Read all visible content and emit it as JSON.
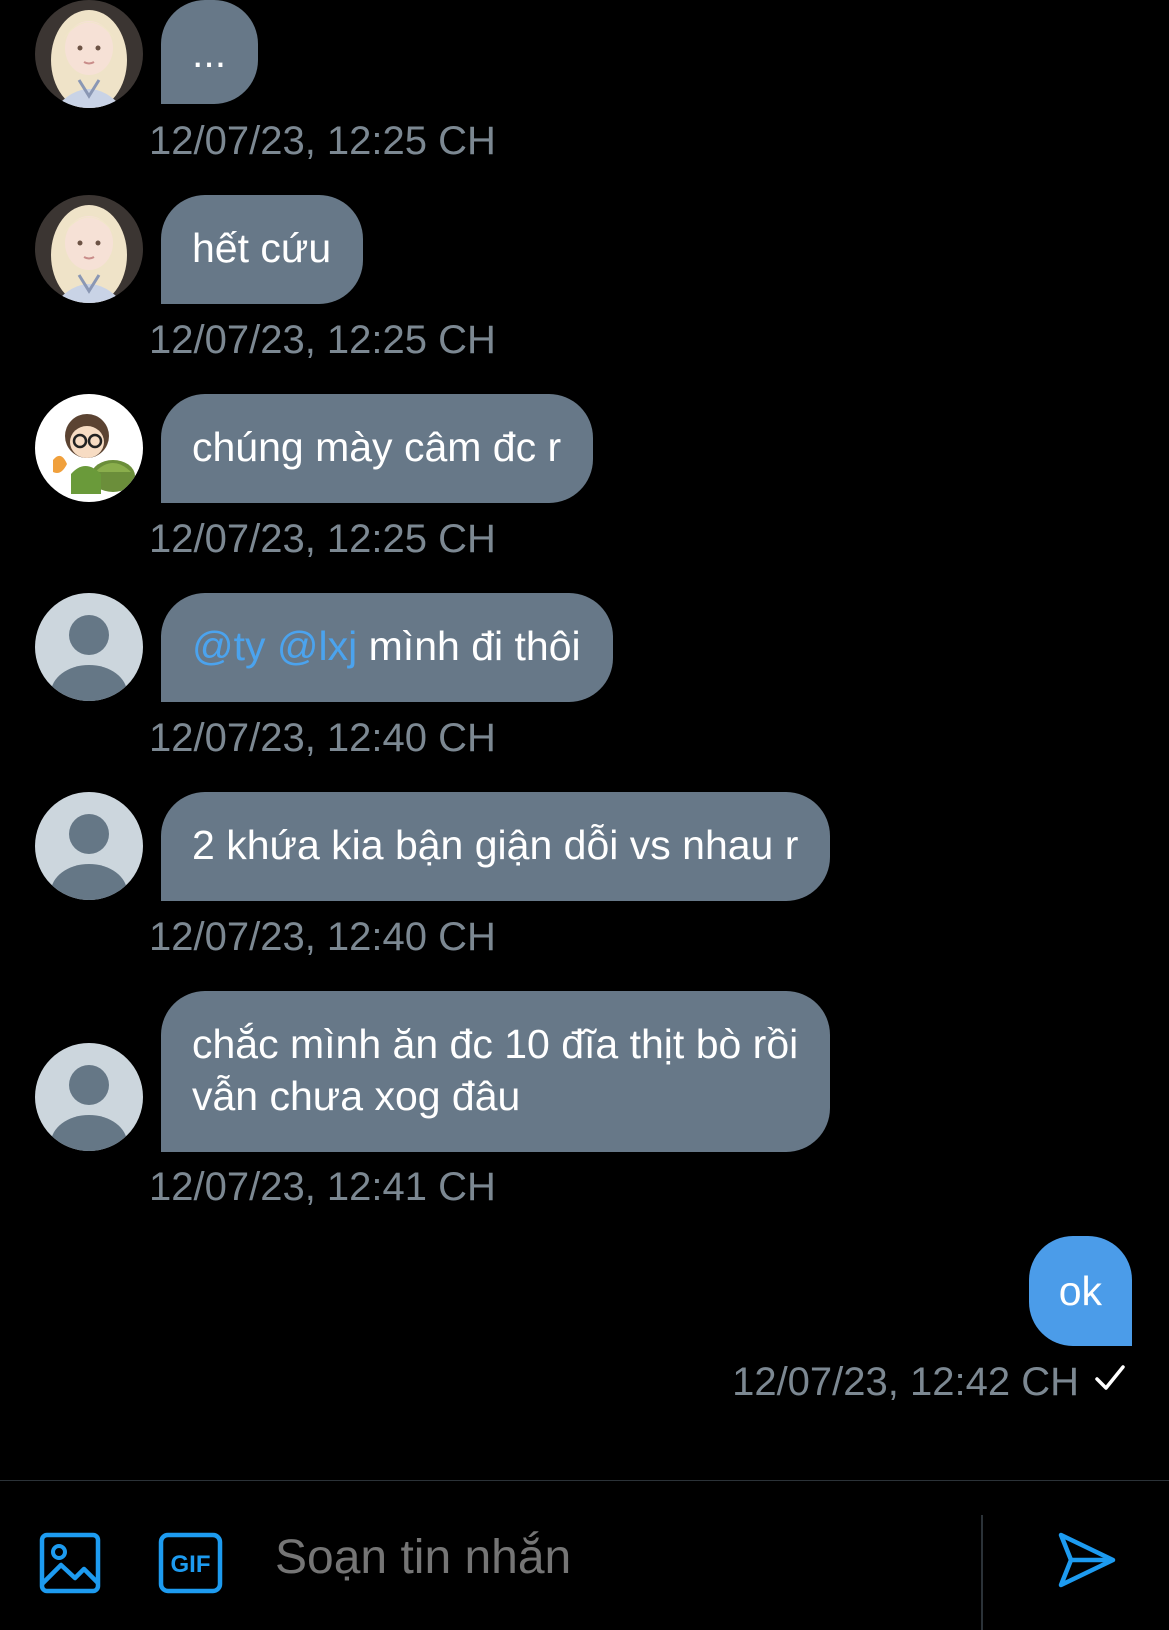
{
  "messages": [
    {
      "avatar": "anime-girl-avatar",
      "text": "...",
      "timestamp": "12/07/23, 12:25 CH"
    },
    {
      "avatar": "anime-girl-avatar",
      "text": "hết cứu",
      "timestamp": "12/07/23, 12:25 CH"
    },
    {
      "avatar": "cartoon-turtle-avatar",
      "text": "chúng mày câm đc r",
      "timestamp": "12/07/23, 12:25 CH"
    },
    {
      "avatar": "default-user-avatar",
      "mentions": [
        "@ty",
        "@lxj"
      ],
      "text": " mình đi thôi",
      "timestamp": "12/07/23, 12:40 CH"
    },
    {
      "avatar": "default-user-avatar",
      "text": "2 khứa kia bận giận dỗi vs nhau r",
      "timestamp": "12/07/23, 12:40 CH"
    },
    {
      "avatar": "default-user-avatar",
      "text_line1": "chắc mình ăn đc 10 đĩa thịt bò rồi",
      "text_line2": "vẫn chưa xog đâu",
      "timestamp": "12/07/23, 12:41 CH"
    }
  ],
  "outgoing": {
    "text": "ok",
    "timestamp": "12/07/23, 12:42 CH",
    "status_icon": "checkmark-icon"
  },
  "composer": {
    "placeholder": "Soạn tin nhắn",
    "image_icon": "image-icon",
    "gif_icon": "gif-icon",
    "gif_label": "GIF",
    "send_icon": "send-icon"
  },
  "colors": {
    "background": "#000000",
    "incoming_bubble": "#677888",
    "outgoing_bubble": "#4b9ce9",
    "mention": "#4ba3ee",
    "timestamp": "#7c8892",
    "accent_icon": "#1d9bf0"
  }
}
